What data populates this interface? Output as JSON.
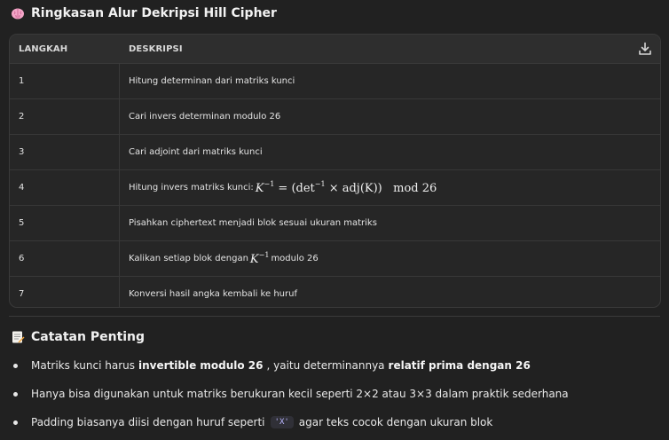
{
  "section1": {
    "icon": "brain-icon",
    "title": "Ringkasan Alur Dekripsi Hill Cipher"
  },
  "table": {
    "headers": {
      "step": "LANGKAH",
      "desc": "DESKRIPSI"
    },
    "download_icon": "download-icon",
    "rows": [
      {
        "step": "1",
        "desc": "Hitung determinan dari matriks kunci"
      },
      {
        "step": "2",
        "desc": "Cari invers determinan modulo 26"
      },
      {
        "step": "3",
        "desc": "Cari adjoint dari matriks kunci"
      },
      {
        "step": "4",
        "desc": "Hitung invers matriks kunci:",
        "math_base": "K",
        "math_sup": "−1",
        "math_rest": " = (det",
        "math_sup2": "−1",
        "math_tail": " × adj(K))   mod 26"
      },
      {
        "step": "5",
        "desc": "Pisahkan ciphertext menjadi blok sesuai ukuran matriks"
      },
      {
        "step": "6",
        "desc": "Kalikan setiap blok dengan",
        "math_base": "K",
        "math_sup": "−1",
        "desc_after": "modulo 26"
      },
      {
        "step": "7",
        "desc": "Konversi hasil angka kembali ke huruf"
      }
    ]
  },
  "section2": {
    "icon": "memo-icon",
    "title": "Catatan Penting"
  },
  "bullets": [
    {
      "pre": "Matriks kunci harus",
      "bold1": "invertible modulo 26",
      "mid": ", yaitu determinannya",
      "bold2": "relatif prima dengan 26"
    },
    {
      "text": "Hanya bisa digunakan untuk matriks berukuran kecil seperti 2×2 atau 3×3 dalam praktik sederhana"
    },
    {
      "pre": "Padding biasanya diisi dengan huruf seperti",
      "code": "'X'",
      "post": "agar teks cocok dengan ukuran blok"
    }
  ]
}
